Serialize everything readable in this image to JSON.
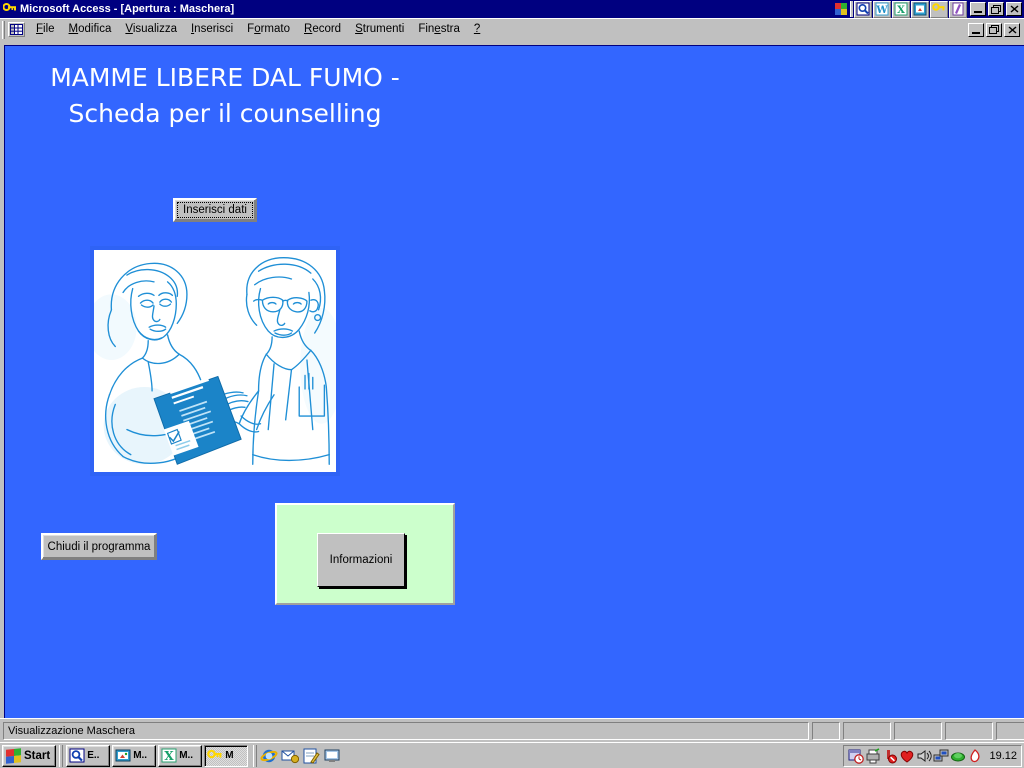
{
  "window": {
    "title": "Microsoft Access - [Apertura : Maschera]",
    "app_icon": "key-icon",
    "minimize_label": "_",
    "restore_label": "❐",
    "close_label": "✕"
  },
  "menubar": {
    "doc_icon": "datasheet-icon",
    "items": [
      {
        "label": "File",
        "accel": "F"
      },
      {
        "label": "Modifica",
        "accel": "M"
      },
      {
        "label": "Visualizza",
        "accel": "V"
      },
      {
        "label": "Inserisci",
        "accel": "I"
      },
      {
        "label": "Formato",
        "accel": "o"
      },
      {
        "label": "Record",
        "accel": "R"
      },
      {
        "label": "Strumenti",
        "accel": "S"
      },
      {
        "label": "Finestra",
        "accel": "e"
      },
      {
        "label": "?",
        "accel": "?"
      }
    ]
  },
  "office_bar": {
    "icons": [
      "office-logo-icon",
      "find-file-icon",
      "word-icon",
      "excel-icon",
      "powerpoint-icon",
      "access-icon",
      "publisher-icon"
    ]
  },
  "form": {
    "background_color": "#3366FF",
    "title": "MAMME LIBERE DAL FUMO -\nScheda per il counselling",
    "title_color": "#FFFFFF",
    "insert_button": "Inserisci dati",
    "close_button": "Chiudi il programma",
    "info_button": "Informazioni",
    "info_panel_color": "#CCFFCC",
    "illustration": {
      "name": "counselling-illustration",
      "description": "Disegno a linee blu: donna incinta riceve un opuscolo da un'ostetrica",
      "line_color": "#1F8FD6",
      "brochure_color": "#1B84C8",
      "background_color": "#FFFFFF"
    }
  },
  "statusbar": {
    "message": "Visualizzazione Maschera",
    "panes": [
      28,
      48,
      48,
      48,
      48,
      48,
      30,
      42
    ]
  },
  "taskbar": {
    "start_label": "Start",
    "tasks": [
      {
        "label": "E..",
        "icon": "explorer-icon",
        "active": false
      },
      {
        "label": "M..",
        "icon": "photoeditor-icon",
        "active": false
      },
      {
        "label": "M..",
        "icon": "excel-icon",
        "active": false
      },
      {
        "label": "M",
        "icon": "access-icon",
        "active": true
      }
    ],
    "quicklaunch": [
      "internet-explorer-icon",
      "outlook-express-icon",
      "notepad-icon",
      "show-desktop-icon"
    ],
    "tray_icons": [
      "scheduler-icon",
      "printer-icon",
      "eject-icon",
      "antivirus-icon",
      "volume-icon",
      "network-icon",
      "modem-icon",
      "power-icon"
    ],
    "clock": "19.12"
  }
}
